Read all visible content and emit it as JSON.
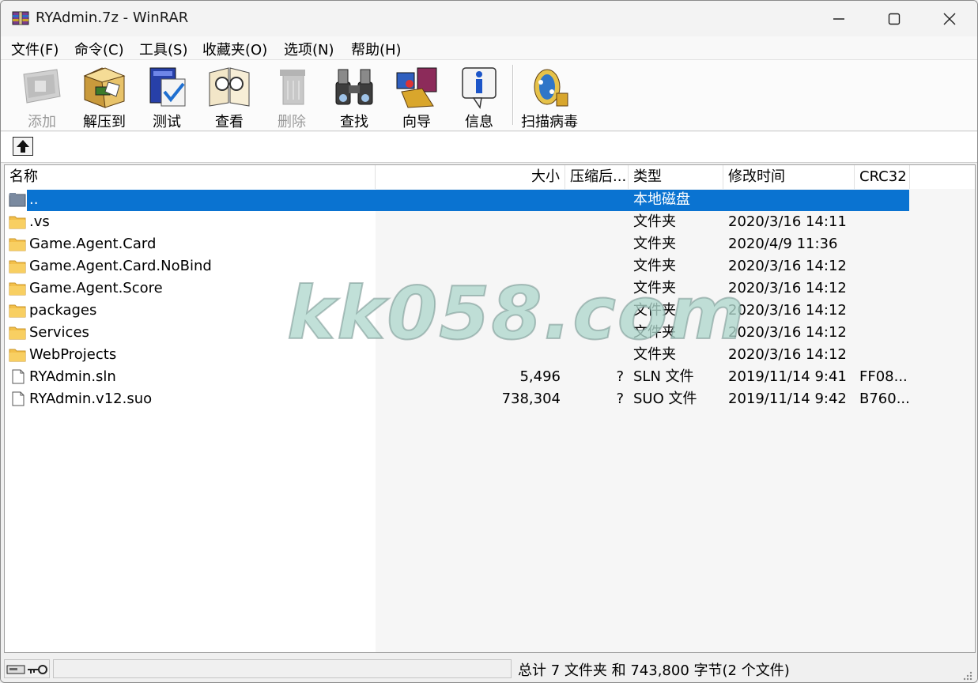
{
  "window": {
    "title": "RYAdmin.7z - WinRAR"
  },
  "menu": [
    "文件(F)",
    "命令(C)",
    "工具(S)",
    "收藏夹(O)",
    "选项(N)",
    "帮助(H)"
  ],
  "toolbar": [
    {
      "label": "添加",
      "icon": "add-icon",
      "disabled": true
    },
    {
      "label": "解压到",
      "icon": "extract-icon",
      "disabled": false
    },
    {
      "label": "测试",
      "icon": "test-icon",
      "disabled": false
    },
    {
      "label": "查看",
      "icon": "view-icon",
      "disabled": false
    },
    {
      "label": "删除",
      "icon": "delete-icon",
      "disabled": true
    },
    {
      "label": "查找",
      "icon": "find-icon",
      "disabled": false
    },
    {
      "label": "向导",
      "icon": "wizard-icon",
      "disabled": false
    },
    {
      "label": "信息",
      "icon": "info-icon",
      "disabled": false
    },
    {
      "label": "扫描病毒",
      "icon": "virus-scan-icon",
      "disabled": false
    }
  ],
  "columns": [
    "名称",
    "大小",
    "压缩后...",
    "类型",
    "修改时间",
    "CRC32"
  ],
  "rows": [
    {
      "name": "..",
      "size": "",
      "packed": "",
      "type": "本地磁盘",
      "modified": "",
      "crc": "",
      "kind": "parent",
      "selected": true
    },
    {
      "name": ".vs",
      "size": "",
      "packed": "",
      "type": "文件夹",
      "modified": "2020/3/16 14:11",
      "crc": "",
      "kind": "folder",
      "selected": false
    },
    {
      "name": "Game.Agent.Card",
      "size": "",
      "packed": "",
      "type": "文件夹",
      "modified": "2020/4/9 11:36",
      "crc": "",
      "kind": "folder",
      "selected": false
    },
    {
      "name": "Game.Agent.Card.NoBind",
      "size": "",
      "packed": "",
      "type": "文件夹",
      "modified": "2020/3/16 14:12",
      "crc": "",
      "kind": "folder",
      "selected": false
    },
    {
      "name": "Game.Agent.Score",
      "size": "",
      "packed": "",
      "type": "文件夹",
      "modified": "2020/3/16 14:12",
      "crc": "",
      "kind": "folder",
      "selected": false
    },
    {
      "name": "packages",
      "size": "",
      "packed": "",
      "type": "文件夹",
      "modified": "2020/3/16 14:12",
      "crc": "",
      "kind": "folder",
      "selected": false
    },
    {
      "name": "Services",
      "size": "",
      "packed": "",
      "type": "文件夹",
      "modified": "2020/3/16 14:12",
      "crc": "",
      "kind": "folder",
      "selected": false
    },
    {
      "name": "WebProjects",
      "size": "",
      "packed": "",
      "type": "文件夹",
      "modified": "2020/3/16 14:12",
      "crc": "",
      "kind": "folder",
      "selected": false
    },
    {
      "name": "RYAdmin.sln",
      "size": "5,496",
      "packed": "?",
      "type": "SLN 文件",
      "modified": "2019/11/14 9:41",
      "crc": "FF08...",
      "kind": "file",
      "selected": false
    },
    {
      "name": "RYAdmin.v12.suo",
      "size": "738,304",
      "packed": "?",
      "type": "SUO 文件",
      "modified": "2019/11/14 9:42",
      "crc": "B760...",
      "kind": "file",
      "selected": false
    }
  ],
  "watermark": "kk058.com",
  "status": {
    "text": "总计 7 文件夹 和 743,800 字节(2 个文件)"
  },
  "colors": {
    "selection": "#0a73d1",
    "folder": "#f3c04a"
  }
}
